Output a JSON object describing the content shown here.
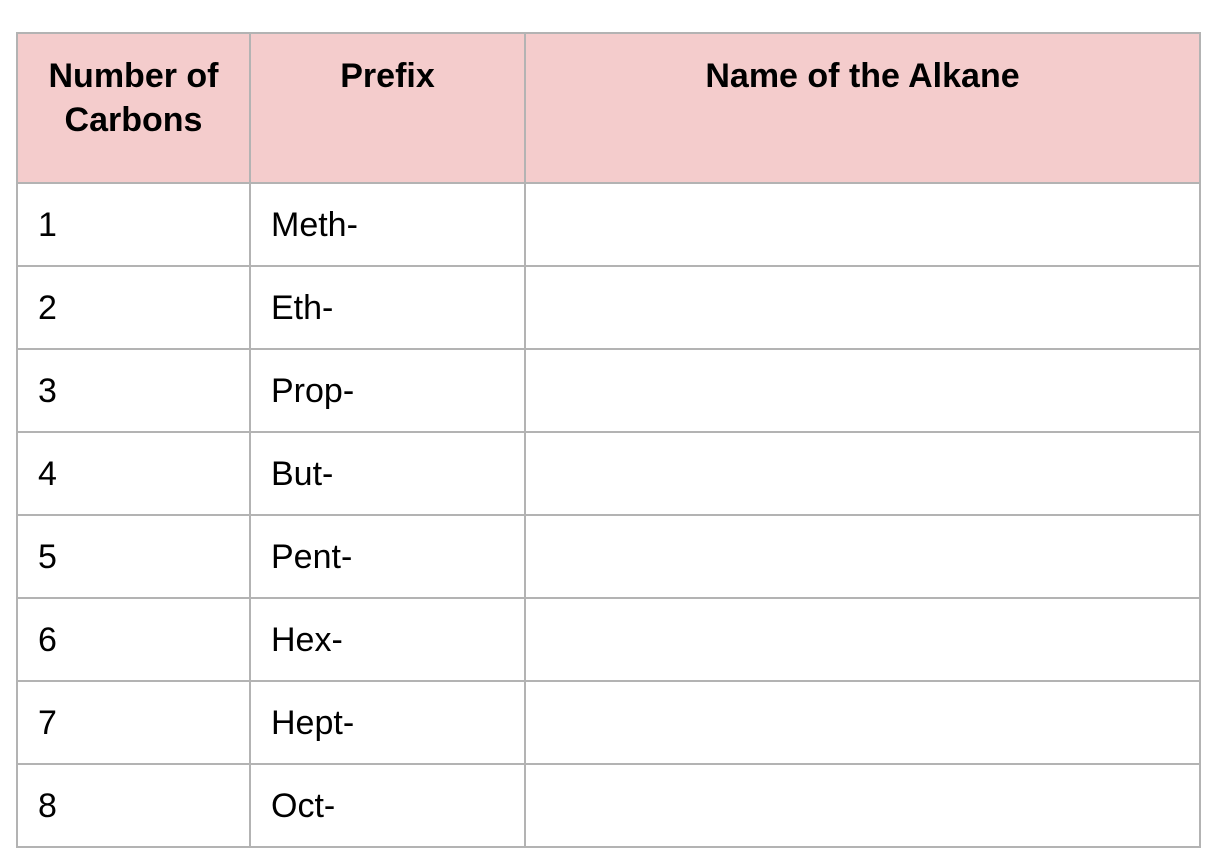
{
  "table": {
    "headers": [
      "Number of Carbons",
      "Prefix",
      "Name of the Alkane"
    ],
    "header_lines": {
      "number_line1": "Number of",
      "number_line2": "Carbons"
    },
    "rows": [
      {
        "carbons": "1",
        "prefix": "Meth-",
        "name": ""
      },
      {
        "carbons": "2",
        "prefix": "Eth-",
        "name": ""
      },
      {
        "carbons": "3",
        "prefix": "Prop-",
        "name": ""
      },
      {
        "carbons": "4",
        "prefix": "But-",
        "name": ""
      },
      {
        "carbons": "5",
        "prefix": "Pent-",
        "name": ""
      },
      {
        "carbons": "6",
        "prefix": "Hex-",
        "name": ""
      },
      {
        "carbons": "7",
        "prefix": "Hept-",
        "name": ""
      },
      {
        "carbons": "8",
        "prefix": "Oct-",
        "name": ""
      }
    ]
  },
  "colors": {
    "header_background": "#f4cccc",
    "grid_line": "#b3b3b3",
    "text": "#000000"
  }
}
